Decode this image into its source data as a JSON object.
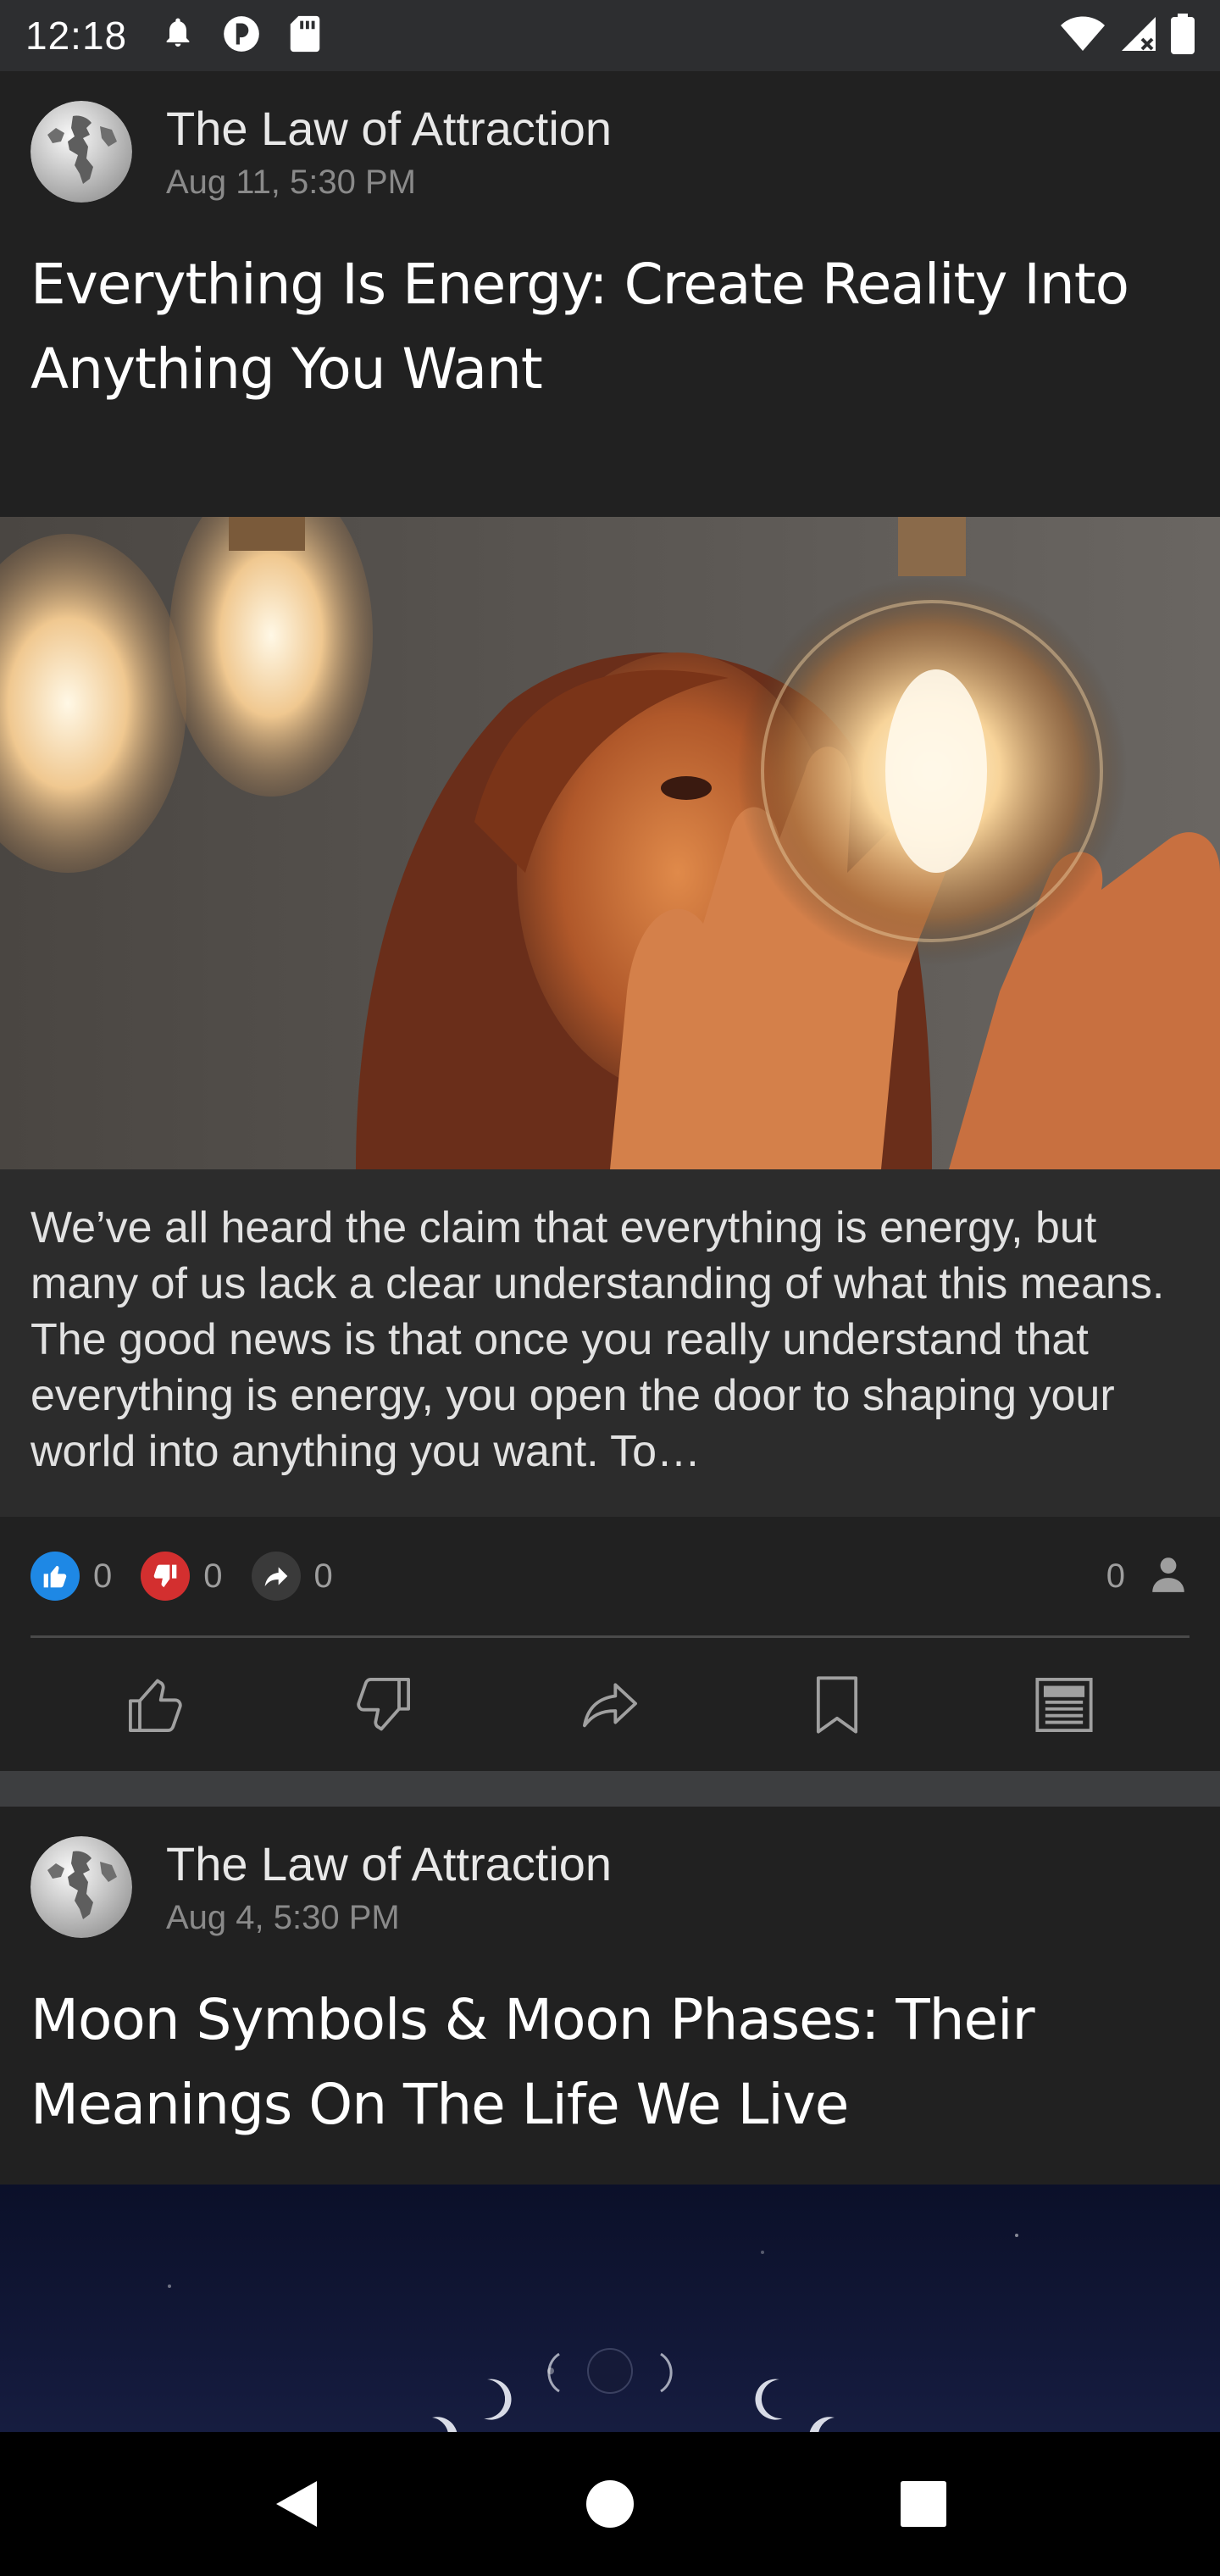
{
  "status_bar": {
    "time": "12:18",
    "icons_left": [
      "bell-icon",
      "data-saver-icon",
      "sd-card-icon"
    ],
    "icons_right": [
      "wifi-icon",
      "signal-icon",
      "battery-icon"
    ]
  },
  "posts": [
    {
      "source": "The Law of Attraction",
      "time": "Aug 11, 5:30 PM",
      "title": "Everything Is Energy: Create Reality Into Anything You Want",
      "image": "woman-holding-glowing-lightbulb",
      "excerpt": "We’ve all heard the claim that everything is energy, but many of us lack a clear understanding of what this means. The good news is that once you really understand that everything is energy, you open the door to shaping your world into anything you want. To…",
      "likes": "0",
      "dislikes": "0",
      "shares": "0",
      "views": "0"
    },
    {
      "source": "The Law of Attraction",
      "time": "Aug 4, 5:30 PM",
      "title": "Moon Symbols & Moon Phases: Their Meanings On The Life We Live",
      "image": "moon-phases-night-sky"
    }
  ],
  "actions": [
    "like-icon",
    "dislike-icon",
    "share-icon",
    "bookmark-icon",
    "article-icon"
  ],
  "colors": {
    "background": "#212121",
    "excerpt_bg": "#2c2c2c",
    "like_badge": "#1e88e5",
    "dislike_badge": "#d32f2f",
    "share_badge": "#3a3a3a",
    "divider_band": "#3d3e40"
  },
  "nav_bar": [
    "back-icon",
    "home-icon",
    "recents-icon"
  ]
}
